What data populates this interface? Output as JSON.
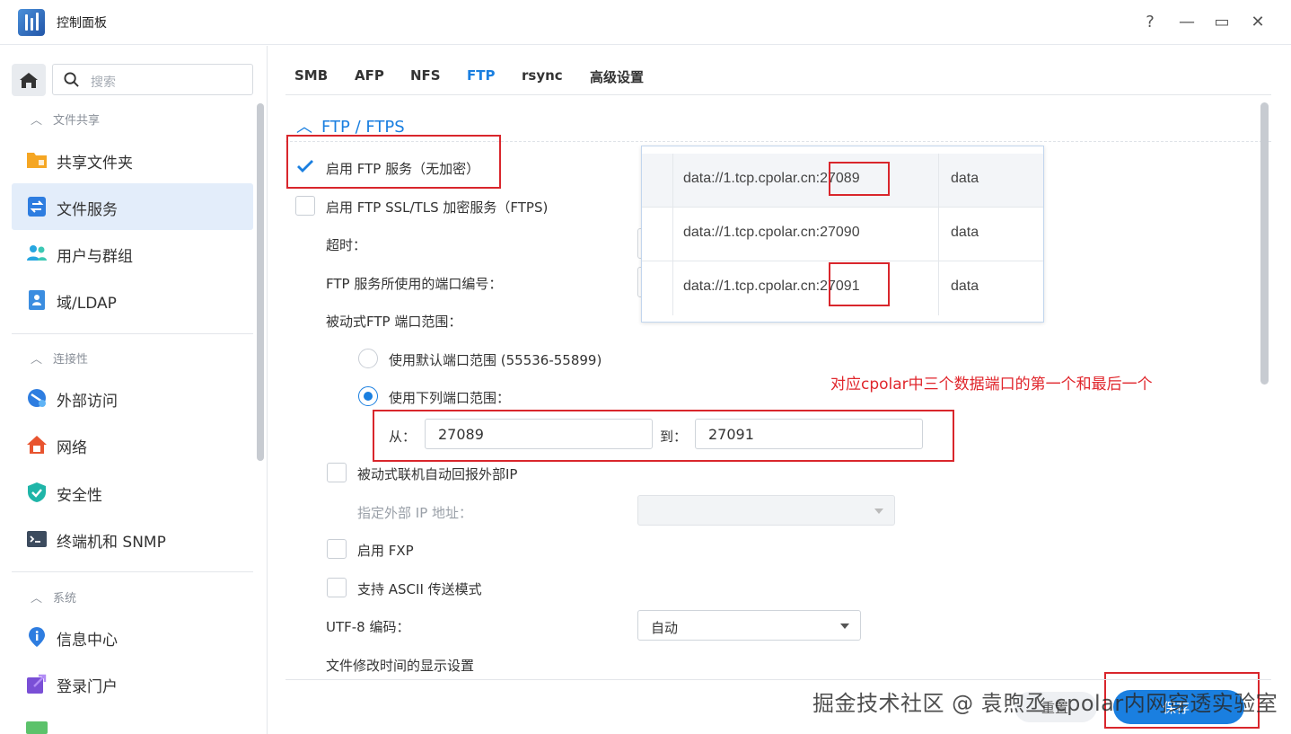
{
  "window": {
    "title": "控制面板",
    "help_glyph": "?",
    "min_glyph": "—",
    "max_glyph": "▭",
    "close_glyph": "✕"
  },
  "sidebar": {
    "search_placeholder": "搜索",
    "sections": [
      {
        "title": "文件共享",
        "items": [
          {
            "label": "共享文件夹",
            "icon": "folder-icon"
          },
          {
            "label": "文件服务",
            "icon": "file-service-icon",
            "active": true
          },
          {
            "label": "用户与群组",
            "icon": "users-icon"
          },
          {
            "label": "域/LDAP",
            "icon": "domain-icon"
          }
        ]
      },
      {
        "title": "连接性",
        "items": [
          {
            "label": "外部访问",
            "icon": "external-access-icon"
          },
          {
            "label": "网络",
            "icon": "network-icon"
          },
          {
            "label": "安全性",
            "icon": "shield-icon"
          },
          {
            "label": "终端机和 SNMP",
            "icon": "terminal-icon"
          }
        ]
      },
      {
        "title": "系统",
        "items": [
          {
            "label": "信息中心",
            "icon": "info-icon"
          },
          {
            "label": "登录门户",
            "icon": "portal-icon"
          }
        ]
      }
    ]
  },
  "tabs": [
    "SMB",
    "AFP",
    "NFS",
    "FTP",
    "rsync",
    "高级设置"
  ],
  "active_tab": "FTP",
  "ftp": {
    "section_title": "FTP / FTPS",
    "enable_ftp": {
      "label": "启用 FTP 服务（无加密）",
      "checked": true
    },
    "enable_ftps": {
      "label": "启用 FTP SSL/TLS 加密服务（FTPS)",
      "checked": false
    },
    "timeout_label": "超时：",
    "port_label": "FTP 服务所使用的端口编号：",
    "passive_range_label": "被动式FTP 端口范围：",
    "default_range": {
      "label": "使用默认端口范围 (55536-55899)",
      "checked": false
    },
    "custom_range": {
      "label": "使用下列端口范围：",
      "checked": true
    },
    "from_label": "从：",
    "from_value": "27089",
    "to_label": "到：",
    "to_value": "27091",
    "report_external_ip": {
      "label": "被动式联机自动回报外部IP",
      "checked": false
    },
    "external_ip_label": "指定外部 IP 地址：",
    "enable_fxp": {
      "label": "启用 FXP",
      "checked": false
    },
    "ascii_mode": {
      "label": "支持 ASCII 传送模式",
      "checked": false
    },
    "utf8_label": "UTF-8 编码：",
    "utf8_value": "自动",
    "mtime_label": "文件修改时间的显示设置"
  },
  "overlay_table": {
    "rows": [
      {
        "address": "data://1.tcp.cpolar.cn:27089",
        "type": "data"
      },
      {
        "address": "data://1.tcp.cpolar.cn:27090",
        "type": "data"
      },
      {
        "address": "data://1.tcp.cpolar.cn:27091",
        "type": "data"
      }
    ]
  },
  "annotation": "对应cpolar中三个数据端口的第一个和最后一个",
  "footer": {
    "reset_label": "重置",
    "save_label": "保存"
  },
  "watermark": "掘金技术社区 @ 袁煦丞 cpolar内网穿透实验室",
  "colors": {
    "accent": "#1a7fe0",
    "annotation_red": "#d9262c"
  }
}
